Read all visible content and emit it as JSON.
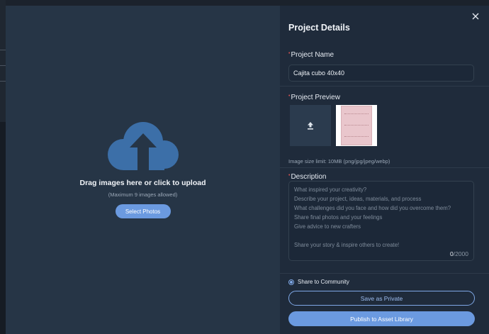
{
  "upload": {
    "title": "Drag images here or click to upload",
    "note": "(Maximum 9 images allowed)",
    "button_label": "Select Photos",
    "icon": "cloud-upload-icon"
  },
  "details": {
    "title": "Project Details",
    "close_icon": "close-icon",
    "project_name": {
      "label": "Project Name",
      "value": "Cajita cubo 40x40"
    },
    "preview": {
      "label": "Project Preview",
      "upload_icon": "upload-arrow-icon",
      "size_note": "Image size limit: 10MB (png/jpg/jpeg/webp)"
    },
    "description": {
      "label": "Description",
      "placeholder_lines": [
        "What inspired your creativity?",
        "Describe your project, ideas, materials, and process",
        "What challenges did you face and how did you overcome them?",
        "Share final photos and your feelings",
        "Give advice to new crafters",
        "",
        "Share your story & inspire others to create!"
      ],
      "count": "0",
      "max": "/2000"
    },
    "share_label": "Share to Community",
    "save_private_label": "Save as Private",
    "publish_label": "Publish to Asset Library"
  },
  "colors": {
    "accent": "#6b9ae0",
    "required": "#e05252",
    "left_pane": "#263546",
    "right_pane": "#1f2b3b"
  }
}
